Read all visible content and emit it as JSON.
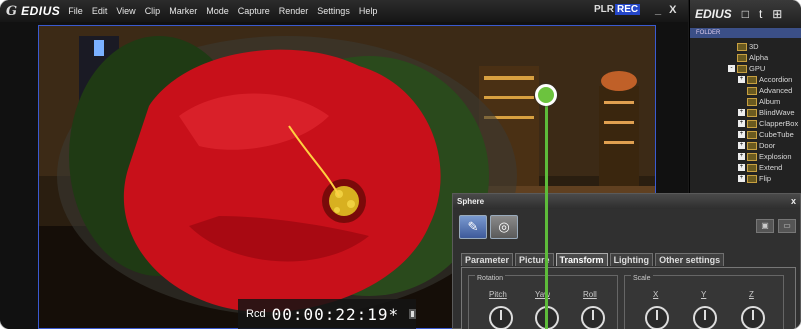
{
  "app": {
    "logo_mark": "G",
    "name": "EDIUS"
  },
  "menu": [
    "File",
    "Edit",
    "View",
    "Clip",
    "Marker",
    "Mode",
    "Capture",
    "Render",
    "Settings",
    "Help"
  ],
  "mode": {
    "plr": "PLR",
    "rec": "REC"
  },
  "window_controls": {
    "minimize": "_",
    "close": "X"
  },
  "timecode": {
    "label": "Rcd",
    "value": "00:00:22:19*"
  },
  "bin": {
    "title": "EDIUS",
    "folder_header": "FOLDER",
    "items": [
      {
        "label": "3D",
        "expander": ""
      },
      {
        "label": "Alpha",
        "expander": ""
      },
      {
        "label": "GPU",
        "expander": "-"
      },
      {
        "label": "Accordion",
        "expander": "+"
      },
      {
        "label": "Advanced",
        "expander": ""
      },
      {
        "label": "Album",
        "expander": ""
      },
      {
        "label": "BlindWave",
        "expander": "+"
      },
      {
        "label": "ClapperBox",
        "expander": "+"
      },
      {
        "label": "CubeTube",
        "expander": "+"
      },
      {
        "label": "Door",
        "expander": "+"
      },
      {
        "label": "Explosion",
        "expander": "+"
      },
      {
        "label": "Extend",
        "expander": "+"
      },
      {
        "label": "Flip",
        "expander": "+"
      }
    ]
  },
  "sphere_dialog": {
    "title": "Sphere",
    "close": "x",
    "tabs": [
      "Parameter",
      "Picture",
      "Transform",
      "Lighting",
      "Other settings"
    ],
    "active_tab": "Transform",
    "rotation": {
      "title": "Rotation",
      "knobs": [
        "Pitch",
        "Yaw",
        "Roll"
      ]
    },
    "scale": {
      "title": "Scale",
      "knobs": [
        "X",
        "Y",
        "Z"
      ]
    }
  },
  "colors": {
    "callout": "#6cc33e",
    "rec_highlight": "#2446c8",
    "flower": "#c8101a"
  }
}
